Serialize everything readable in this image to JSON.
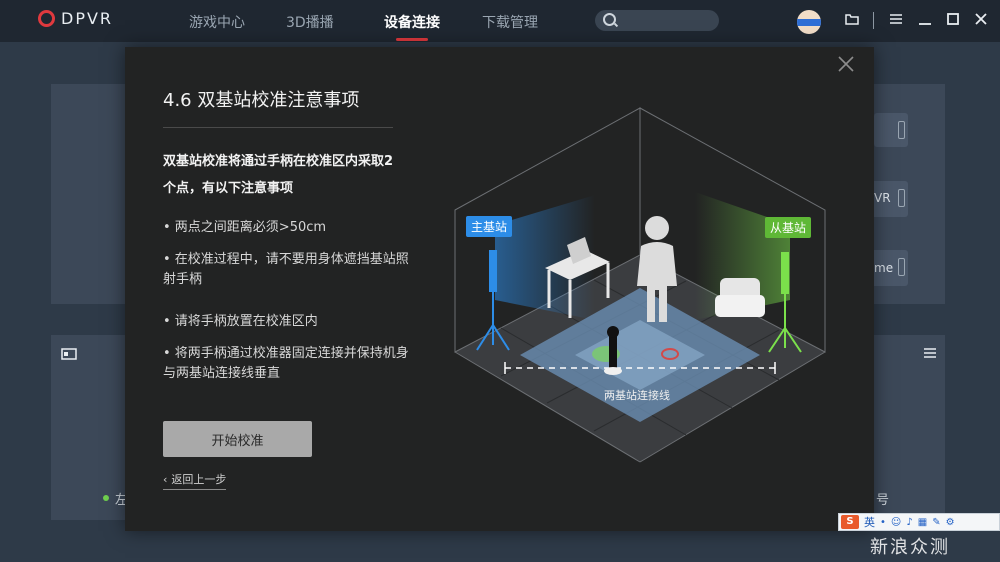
{
  "app": {
    "logo_text": "DPVR"
  },
  "nav": {
    "tabs": [
      {
        "label": "游戏中心"
      },
      {
        "label": "3D播播"
      },
      {
        "label": "设备连接",
        "active": true
      },
      {
        "label": "下载管理"
      }
    ]
  },
  "search": {
    "placeholder": ""
  },
  "window_controls": [
    "folder-icon",
    "menu-icon",
    "minimize-icon",
    "maximize-icon",
    "close-icon"
  ],
  "background": {
    "btn_vr": "VR",
    "btn_me": "me",
    "status_left": "左",
    "status_right": "号"
  },
  "dialog": {
    "title": "4.6 双基站校准注意事项",
    "intro": "双基站校准将通过手柄在校准区内采取2个点，有以下注意事项",
    "notes": [
      "• 两点之间距离必须>50cm",
      "• 在校准过程中，请不要用身体遮挡基站照射手柄",
      "• 请将手柄放置在校准区内",
      "• 将两手柄通过校准器固定连接并保持机身与两基站连接线垂直"
    ],
    "start_button": "开始校准",
    "back_link": "返回上一步"
  },
  "illustration": {
    "master_station": "主基站",
    "slave_station": "从基站",
    "line_caption": "两基站连接线",
    "colors": {
      "master": "#2d8de8",
      "slave": "#7be04b",
      "floor_zone": "#6e93b9"
    }
  },
  "ime": {
    "logo": "S",
    "mode": "英"
  },
  "watermark": "新浪众测"
}
